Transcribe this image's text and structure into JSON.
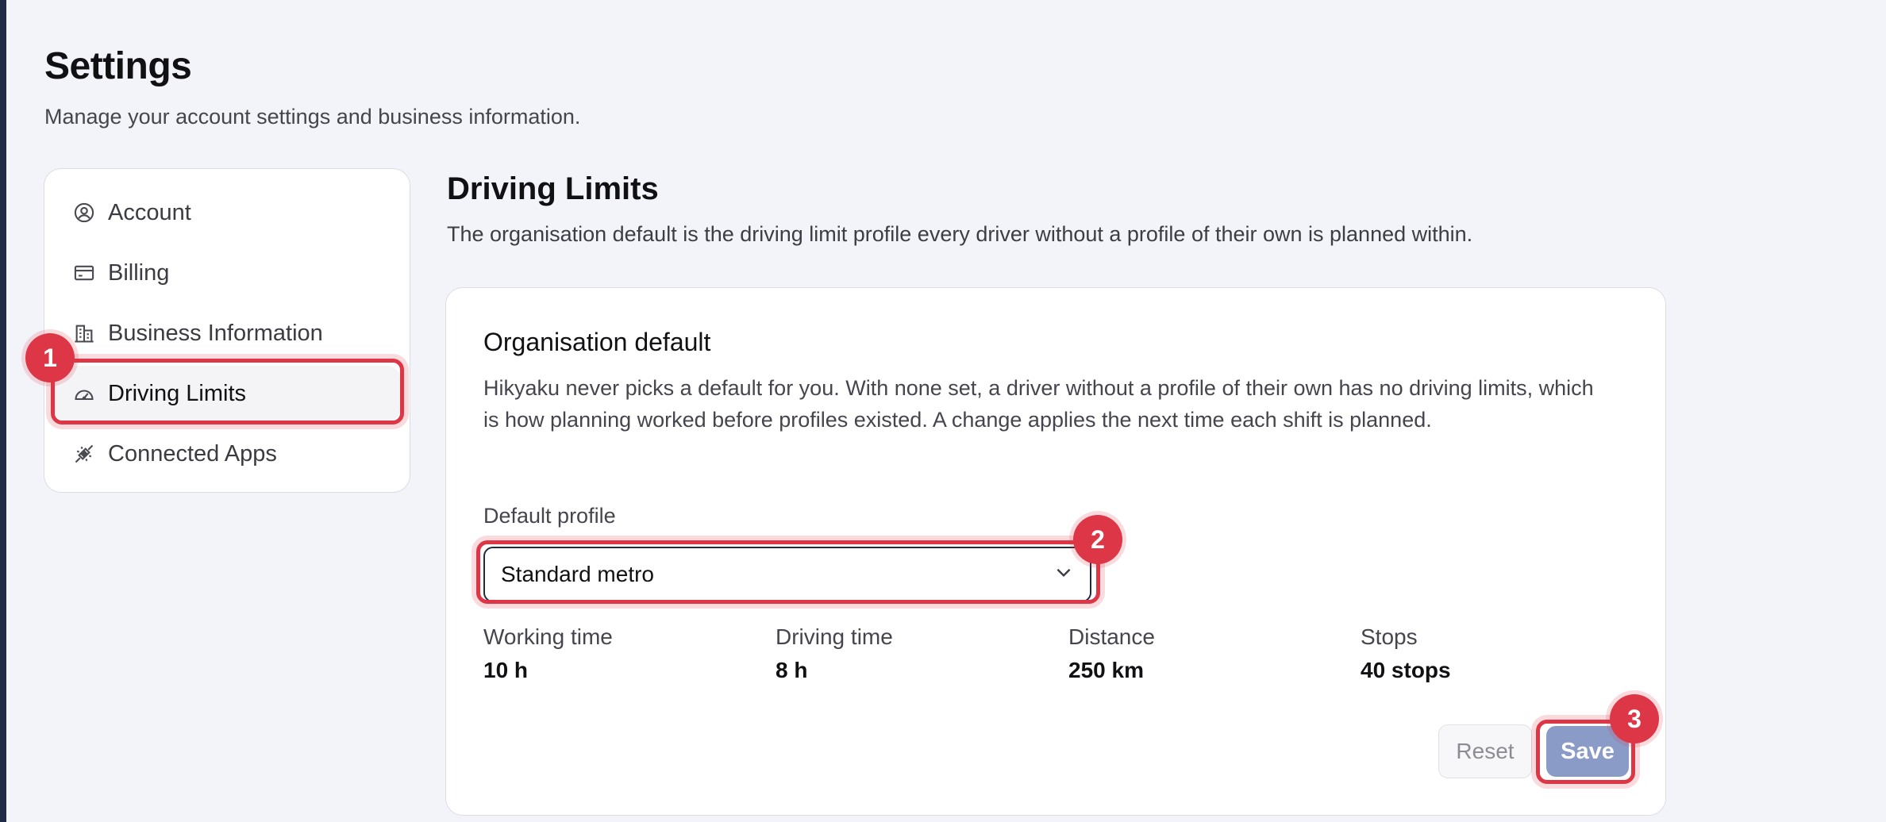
{
  "page": {
    "title": "Settings",
    "subtitle": "Manage your account settings and business information."
  },
  "sidebar": {
    "items": [
      {
        "label": "Account",
        "icon": "account-circle-icon"
      },
      {
        "label": "Billing",
        "icon": "credit-card-icon"
      },
      {
        "label": "Business Information",
        "icon": "building-icon"
      },
      {
        "label": "Driving Limits",
        "icon": "speedometer-icon",
        "active": true
      },
      {
        "label": "Connected Apps",
        "icon": "plug-icon"
      }
    ]
  },
  "main": {
    "title": "Driving Limits",
    "description": "The organisation default is the driving limit profile every driver without a profile of their own is planned within."
  },
  "card": {
    "title": "Organisation default",
    "description": "Hikyaku never picks a default for you. With none set, a driver without a profile of their own has no driving limits, which is how planning worked before profiles existed. A change applies the next time each shift is planned.",
    "field_label": "Default profile",
    "selected_profile": "Standard metro",
    "stats": [
      {
        "label": "Working time",
        "value": "10 h"
      },
      {
        "label": "Driving time",
        "value": "8 h"
      },
      {
        "label": "Distance",
        "value": "250 km"
      },
      {
        "label": "Stops",
        "value": "40 stops"
      }
    ],
    "reset_label": "Reset",
    "save_label": "Save"
  },
  "annotations": {
    "badges": [
      "1",
      "2",
      "3"
    ],
    "color": "#dd3646"
  },
  "colors": {
    "background": "#f3f4fa",
    "save_button": "#8b9bc7",
    "select_border": "#1f2a44"
  }
}
